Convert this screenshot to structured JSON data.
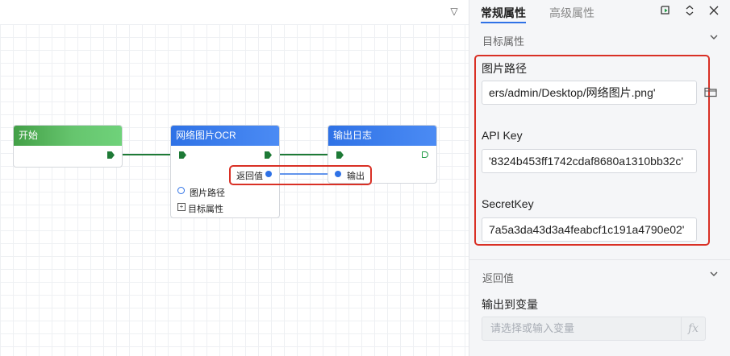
{
  "canvas": {
    "nodes": [
      {
        "title": "开始",
        "color": "#4caf50"
      },
      {
        "title": "网络图片OCR",
        "color": "#2f72e6",
        "output_label": "返回值",
        "param1": "图片路径",
        "param2": "目标属性"
      },
      {
        "title": "输出日志",
        "color": "#2f72e6",
        "input_label": "输出"
      }
    ]
  },
  "panel": {
    "tabs": [
      {
        "label": "常规属性",
        "active": true
      },
      {
        "label": "高级属性",
        "active": false
      }
    ],
    "section_target": {
      "title": "目标属性"
    },
    "fields": {
      "image_path": {
        "label": "图片路径",
        "value": "ers/admin/Desktop/网络图片.png'"
      },
      "api_key": {
        "label": "API Key",
        "value": "'8324b453ff1742cdaf8680a1310bb32c'"
      },
      "secret_key": {
        "label": "SecretKey",
        "value": "7a5a3da43d3a4feabcf1c191a4790e02'"
      }
    },
    "section_return": {
      "title": "返回值"
    },
    "output_var": {
      "label": "输出到变量",
      "placeholder": "请选择或输入变量",
      "fx": "fx"
    }
  },
  "colors": {
    "accent": "#2f72e6",
    "highlight": "#d93025",
    "wire": "#1e7a36"
  },
  "icons": [
    "collapse-icon",
    "run-icon",
    "expand-collapse-icon",
    "close-icon",
    "folder-icon"
  ]
}
